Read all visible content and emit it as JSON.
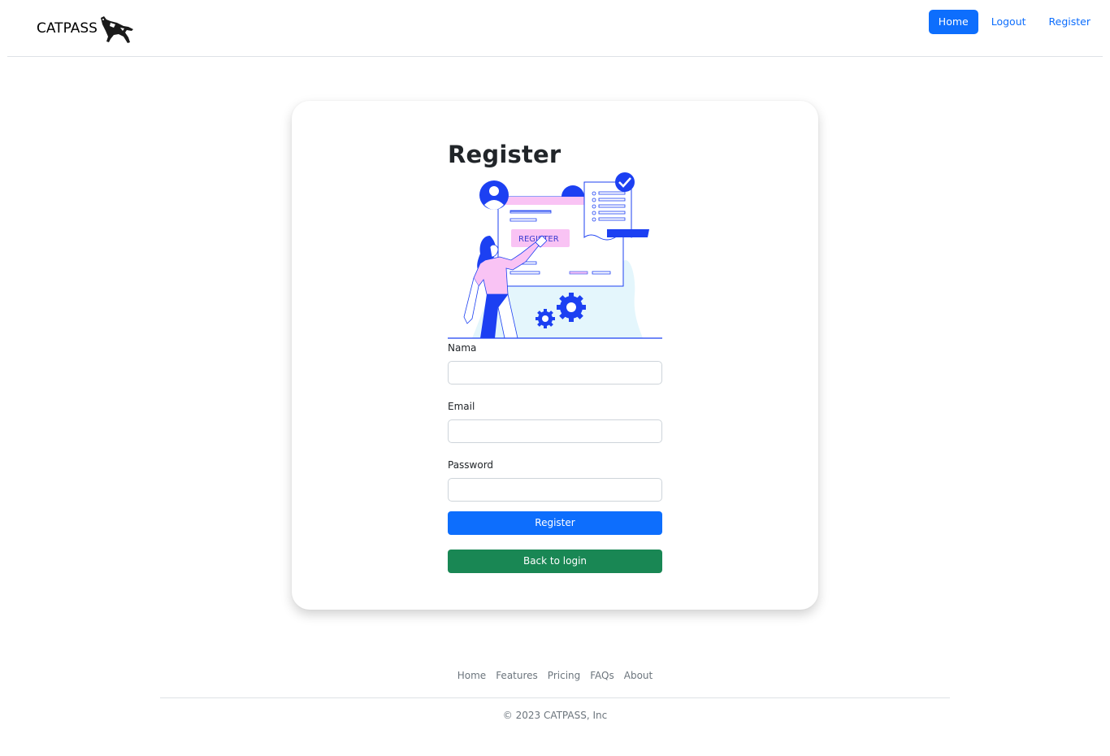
{
  "navbar": {
    "brand": "CATPASS",
    "links": [
      {
        "label": "Home",
        "active": true
      },
      {
        "label": "Logout",
        "active": false
      },
      {
        "label": "Register",
        "active": false
      }
    ]
  },
  "form": {
    "title": "Register",
    "illustration_text": "REGISTER",
    "fields": {
      "name_label": "Nama",
      "email_label": "Email",
      "password_label": "Password"
    },
    "register_button": "Register",
    "back_button": "Back to login"
  },
  "footer": {
    "links": [
      "Home",
      "Features",
      "Pricing",
      "FAQs",
      "About"
    ],
    "copyright": "© 2023 CATPASS, Inc"
  },
  "colors": {
    "primary": "#0d6efd",
    "success": "#198754",
    "illustration_blue": "#1c40f2",
    "illustration_pink": "#f9c3f4",
    "illustration_bg": "#e4f6fc"
  }
}
